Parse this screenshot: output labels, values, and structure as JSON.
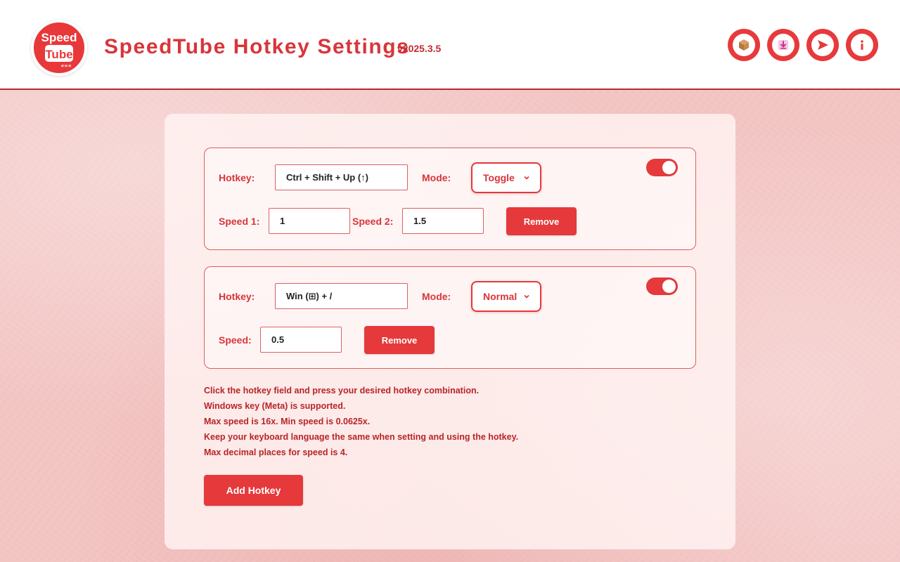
{
  "header": {
    "logo_top": "Speed",
    "logo_bottom": "Tube",
    "title": "SpeedTube Hotkey Settings",
    "version": "v2025.3.5"
  },
  "hotkeys": [
    {
      "hotkey_label": "Hotkey:",
      "hotkey_value": "Ctrl + Shift + Up (↑)",
      "mode_label": "Mode:",
      "mode_value": "Toggle",
      "speed1_label": "Speed 1:",
      "speed1_value": "1",
      "speed2_label": "Speed 2:",
      "speed2_value": "1.5",
      "remove_label": "Remove",
      "enabled": true
    },
    {
      "hotkey_label": "Hotkey:",
      "hotkey_value": "Win (⊞) + /",
      "mode_label": "Mode:",
      "mode_value": "Normal",
      "speed_label": "Speed:",
      "speed_value": "0.5",
      "remove_label": "Remove",
      "enabled": true
    }
  ],
  "notes": [
    "Click the hotkey field and press your desired hotkey combination.",
    "Windows key (Meta) is supported.",
    "Max speed is 16x. Min speed is 0.0625x.",
    "Keep your keyboard language the same when setting and using the hotkey.",
    "Max decimal places for speed is 4."
  ],
  "add_button_label": "Add Hotkey",
  "colors": {
    "accent": "#e5393b",
    "text_red": "#d8353a",
    "note_red": "#b82428"
  },
  "icons": [
    "package-icon",
    "download-icon",
    "send-icon",
    "info-icon"
  ]
}
